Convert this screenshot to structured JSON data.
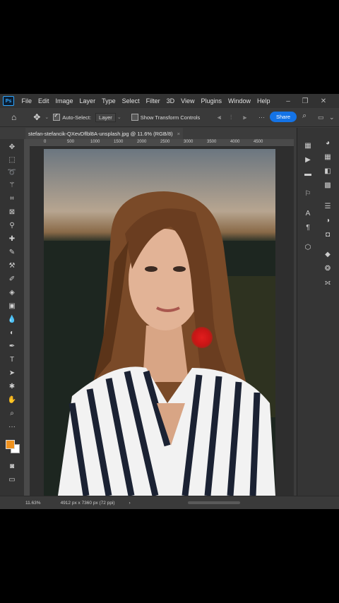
{
  "menu": {
    "logo": "Ps",
    "items": [
      "File",
      "Edit",
      "Image",
      "Layer",
      "Type",
      "Select",
      "Filter",
      "3D",
      "View",
      "Plugins",
      "Window",
      "Help"
    ]
  },
  "options": {
    "auto_select_label": "Auto-Select:",
    "auto_select_value": "Layer",
    "transform_label": "Show Transform Controls",
    "share_label": "Share"
  },
  "document": {
    "tab_title": "stefan-stefancik-QXevDflbl8A-unsplash.jpg @ 11.6% (RGB/8)",
    "close_glyph": "×"
  },
  "ruler": {
    "h_ticks": [
      "0",
      "500",
      "1000",
      "1500",
      "2000",
      "2500",
      "3000",
      "3500",
      "4000",
      "4500"
    ]
  },
  "status": {
    "zoom": "11.63%",
    "doc_info": "4912 px x 7360 px (72 ppi)",
    "arrow": "›"
  },
  "colors": {
    "foreground": "#f0921e",
    "background": "#ffffff",
    "accent": "#1473e6"
  }
}
